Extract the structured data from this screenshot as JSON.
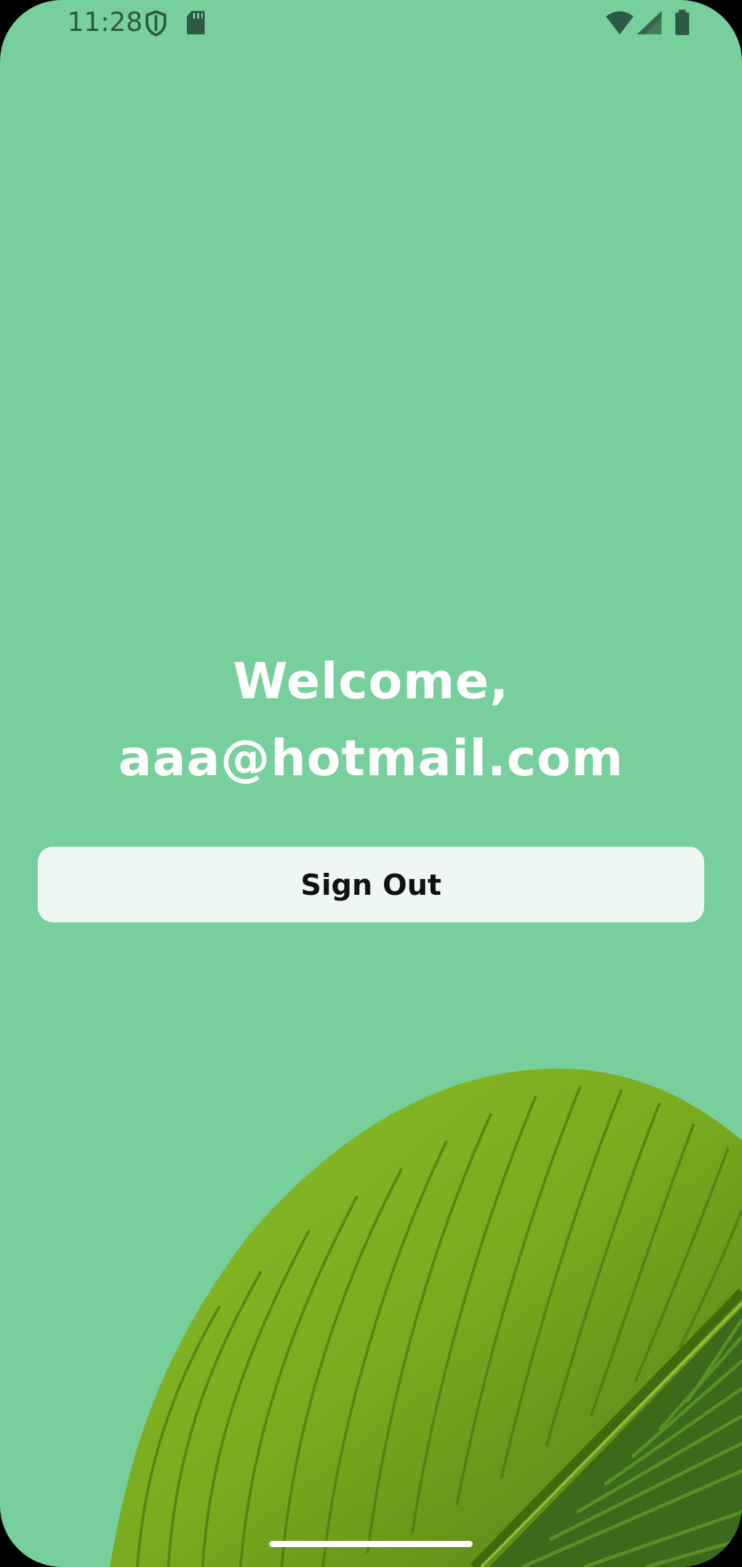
{
  "status_bar": {
    "time": "11:28"
  },
  "welcome": {
    "line1": "Welcome,",
    "line2": "aaa@hotmail.com"
  },
  "sign_out": {
    "label": "Sign Out"
  },
  "colors": {
    "background": "#77cf9b",
    "button_bg": "#eef7f1",
    "text": "#ffffff"
  }
}
